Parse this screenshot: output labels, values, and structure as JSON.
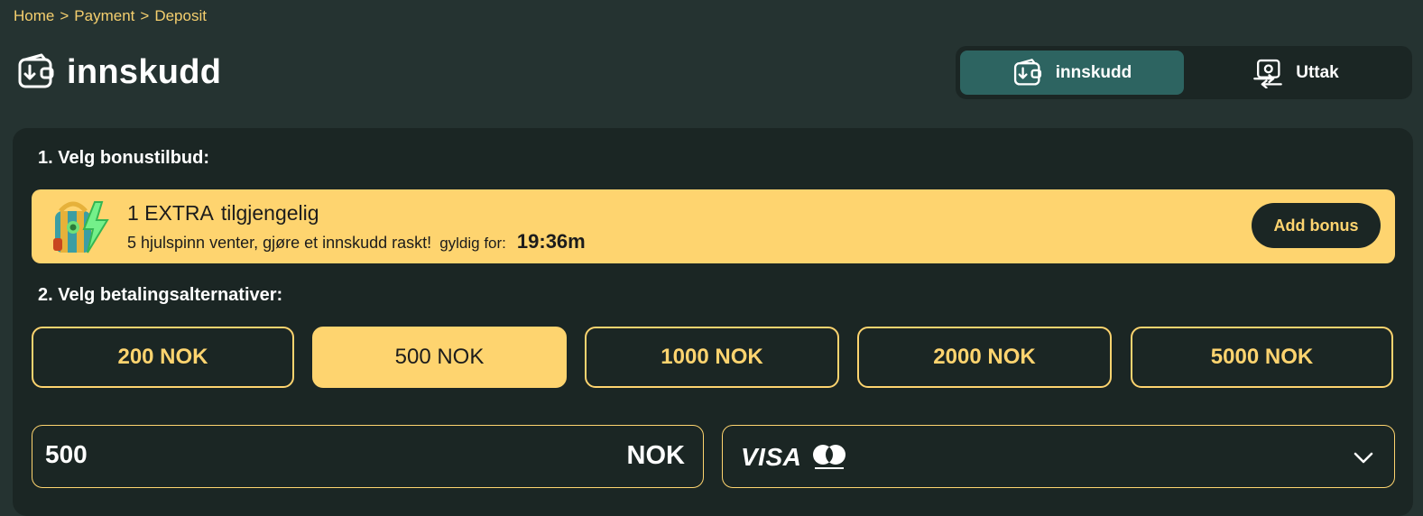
{
  "breadcrumb": {
    "items": [
      "Home",
      "Payment",
      "Deposit"
    ],
    "separator": ">"
  },
  "page": {
    "title": "innskudd",
    "icon": "wallet-deposit-icon"
  },
  "tabs": [
    {
      "label": "innskudd",
      "icon": "wallet-deposit-icon",
      "active": true
    },
    {
      "label": "Uttak",
      "icon": "cash-withdraw-icon",
      "active": false
    }
  ],
  "sections": {
    "bonus_label": "1. Velg bonustilbud:",
    "payment_label": "2. Velg betalingsalternativer:"
  },
  "bonus": {
    "count_label": "1 EXTRA",
    "available_label": "tilgjengelig",
    "description": "5 hjulspinn venter, gjøre et innskudd raskt!",
    "valid_label": "gyldig for:",
    "timer": "19:36m",
    "button_label": "Add bonus",
    "icon": "gift-bag-bolt-icon"
  },
  "amount_options": [
    {
      "label": "200 NOK",
      "selected": false
    },
    {
      "label": "500 NOK",
      "selected": true
    },
    {
      "label": "1000 NOK",
      "selected": false
    },
    {
      "label": "2000 NOK",
      "selected": false
    },
    {
      "label": "5000 NOK",
      "selected": false
    }
  ],
  "amount_input": {
    "value": "500",
    "currency": "NOK"
  },
  "payment_method": {
    "selected": "VISA",
    "logos": [
      "visa-logo",
      "mastercard-logo"
    ]
  },
  "colors": {
    "background": "#253331",
    "card": "#1b2624",
    "accent": "#fed46f",
    "active_tab": "#2d6461",
    "breadcrumb": "#f5cf6e"
  }
}
